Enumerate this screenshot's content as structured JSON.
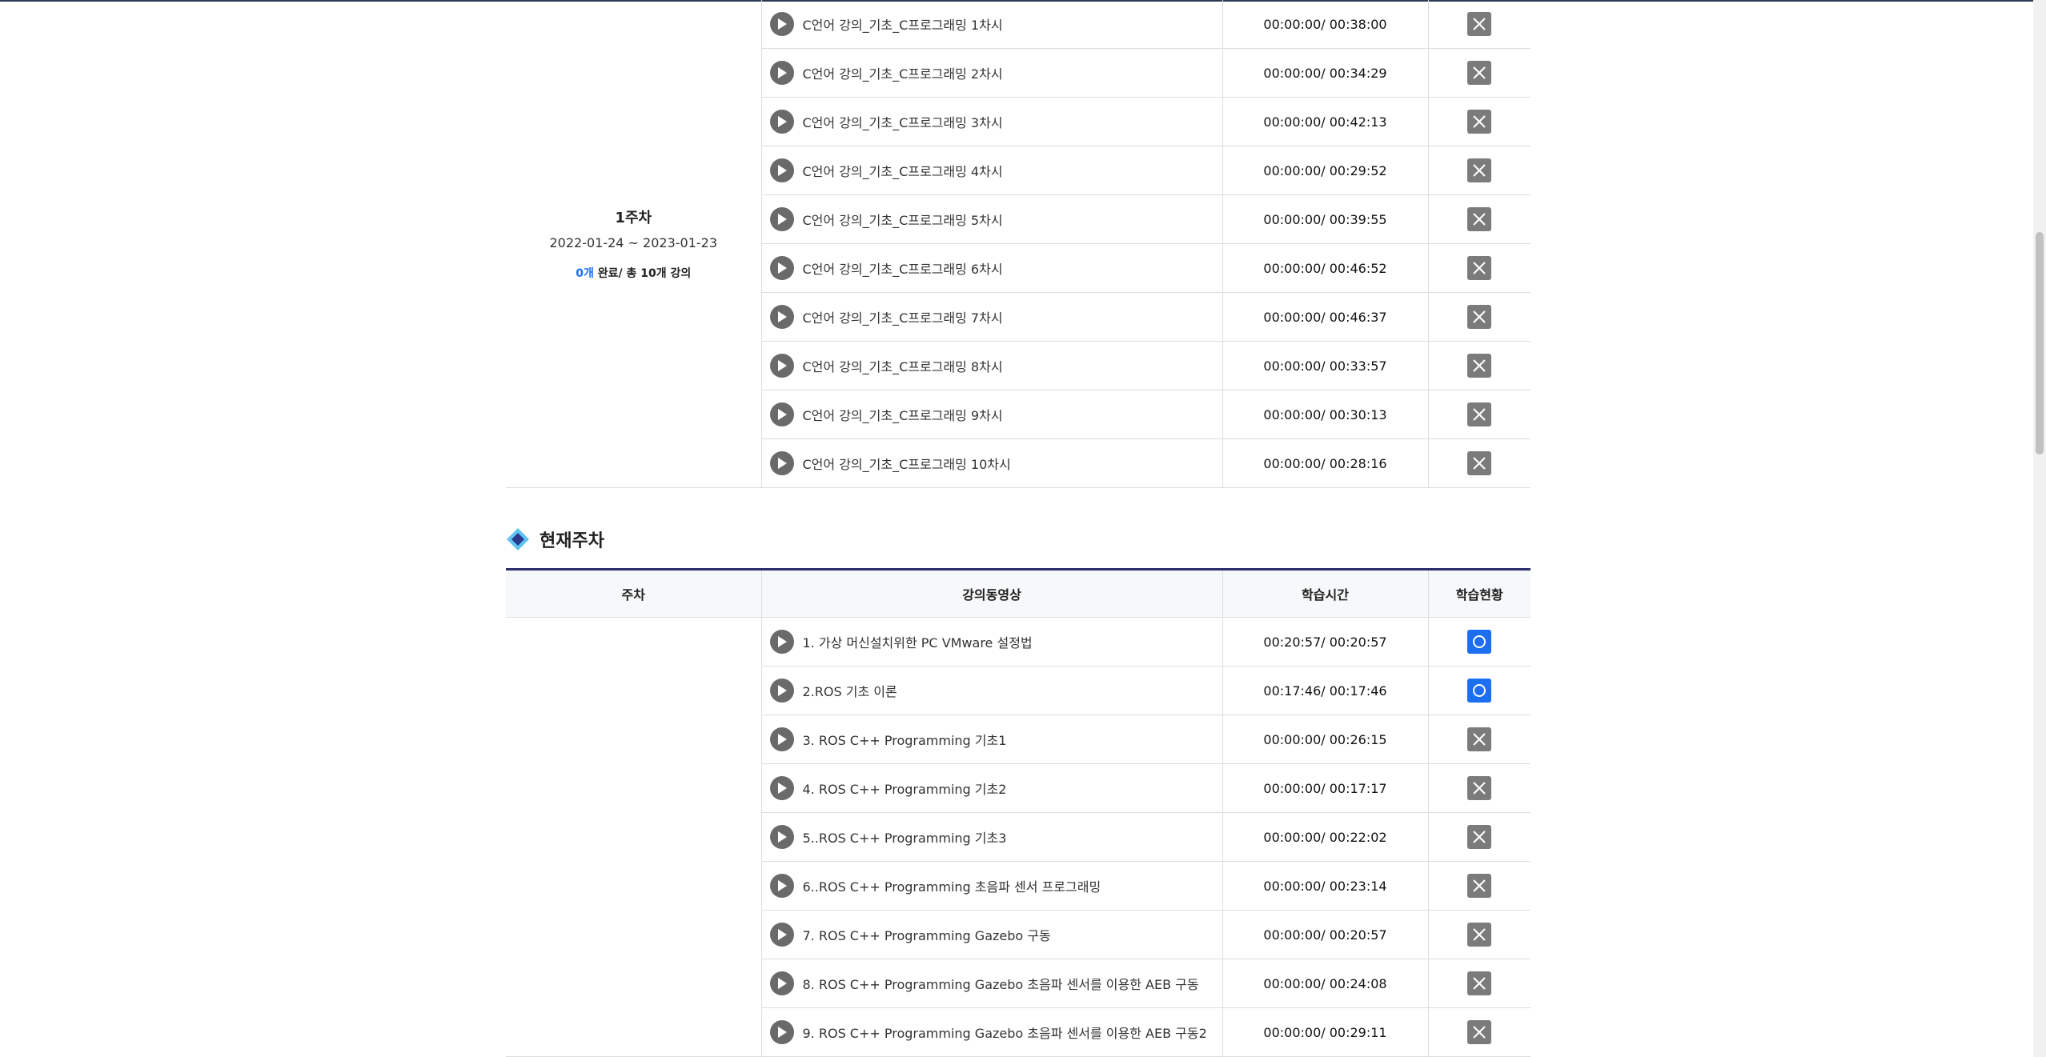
{
  "week_summary": {
    "title": "1주차",
    "period": "2022-01-24 ~ 2023-01-23",
    "completed": "0개",
    "progress_suffix": " 완료/ 총 10개 강의"
  },
  "past_lectures": [
    {
      "title": "C언어 강의_기초_C프로그래밍 1차시",
      "time": "00:00:00/ 00:38:00",
      "status": "x"
    },
    {
      "title": "C언어 강의_기초_C프로그래밍 2차시",
      "time": "00:00:00/ 00:34:29",
      "status": "x"
    },
    {
      "title": "C언어 강의_기초_C프로그래밍 3차시",
      "time": "00:00:00/ 00:42:13",
      "status": "x"
    },
    {
      "title": "C언어 강의_기초_C프로그래밍 4차시",
      "time": "00:00:00/ 00:29:52",
      "status": "x"
    },
    {
      "title": "C언어 강의_기초_C프로그래밍 5차시",
      "time": "00:00:00/ 00:39:55",
      "status": "x"
    },
    {
      "title": "C언어 강의_기초_C프로그래밍 6차시",
      "time": "00:00:00/ 00:46:52",
      "status": "x"
    },
    {
      "title": "C언어 강의_기초_C프로그래밍 7차시",
      "time": "00:00:00/ 00:46:37",
      "status": "x"
    },
    {
      "title": "C언어 강의_기초_C프로그래밍 8차시",
      "time": "00:00:00/ 00:33:57",
      "status": "x"
    },
    {
      "title": "C언어 강의_기초_C프로그래밍 9차시",
      "time": "00:00:00/ 00:30:13",
      "status": "x"
    },
    {
      "title": "C언어 강의_기초_C프로그래밍 10차시",
      "time": "00:00:00/ 00:28:16",
      "status": "x"
    }
  ],
  "current_section": {
    "title": "현재주차",
    "headers": {
      "week": "주차",
      "video": "강의동영상",
      "time": "학습시간",
      "status": "학습현황"
    }
  },
  "current_lectures": [
    {
      "title": "1. 가상 머신설치위한 PC VMware 설정법",
      "time": "00:20:57/ 00:20:57",
      "status": "o"
    },
    {
      "title": "2.ROS 기초 이론",
      "time": "00:17:46/ 00:17:46",
      "status": "o"
    },
    {
      "title": "3. ROS C++ Programming 기초1",
      "time": "00:00:00/ 00:26:15",
      "status": "x"
    },
    {
      "title": "4. ROS C++ Programming 기초2",
      "time": "00:00:00/ 00:17:17",
      "status": "x"
    },
    {
      "title": "5..ROS C++ Programming 기초3",
      "time": "00:00:00/ 00:22:02",
      "status": "x"
    },
    {
      "title": "6..ROS C++ Programming 초음파 센서 프로그래밍",
      "time": "00:00:00/ 00:23:14",
      "status": "x"
    },
    {
      "title": "7. ROS C++ Programming Gazebo 구동",
      "time": "00:00:00/ 00:20:57",
      "status": "x"
    },
    {
      "title": "8. ROS C++ Programming Gazebo 초음파 센서를 이용한 AEB 구동",
      "time": "00:00:00/ 00:24:08",
      "status": "x"
    },
    {
      "title": "9. ROS C++ Programming Gazebo 초음파 센서를 이용한 AEB 구동2",
      "time": "00:00:00/ 00:29:11",
      "status": "x"
    }
  ],
  "colors": {
    "accent": "#1d6ff2",
    "header_rule": "#2b2f6f",
    "incomplete": "#7b7b7b"
  }
}
